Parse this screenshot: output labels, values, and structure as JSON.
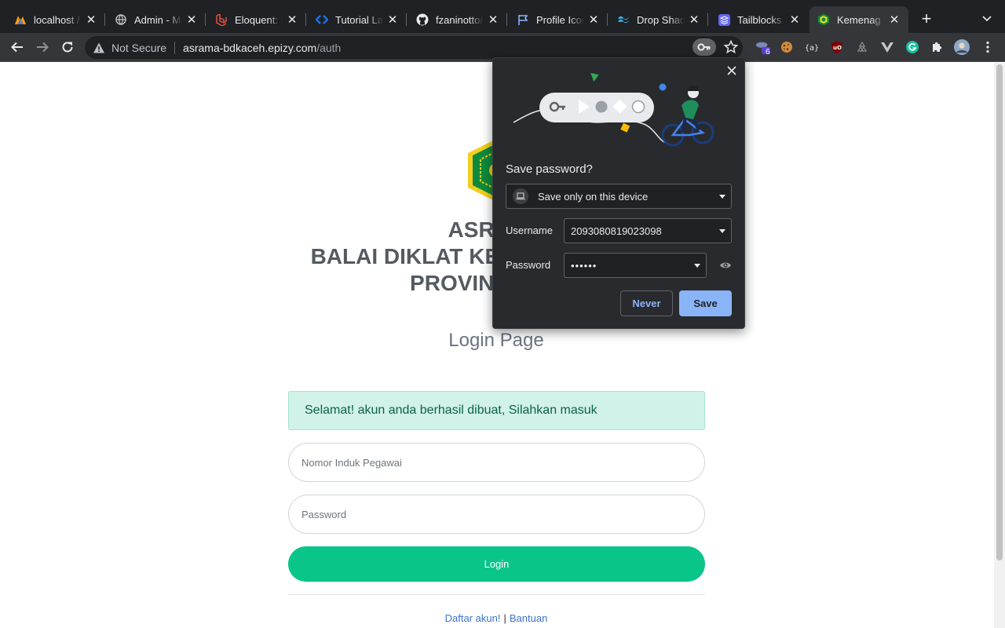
{
  "browser": {
    "tabs": [
      {
        "title": "localhost / ",
        "icon": "phpmyadmin-icon"
      },
      {
        "title": "Admin - Mu",
        "icon": "globe-icon"
      },
      {
        "title": "Eloquent: M",
        "icon": "laravel-icon"
      },
      {
        "title": "Tutorial Lar",
        "icon": "code-icon"
      },
      {
        "title": "fzaninotto/f",
        "icon": "github-icon"
      },
      {
        "title": "Profile Icon",
        "icon": "flag-icon"
      },
      {
        "title": "Drop Shado",
        "icon": "tailwind-icon"
      },
      {
        "title": "Tailblocks -",
        "icon": "stack-icon"
      },
      {
        "title": "Kemenag L",
        "icon": "kemenag-icon",
        "active": true
      }
    ],
    "new_tab_label": "+",
    "security_label": "Not Secure",
    "url_host": "asrama-bdkaceh.epizy.com",
    "url_path": "/auth",
    "extension_badge": "6"
  },
  "page": {
    "heading_line1": "ASRAMA",
    "heading_line2": "BALAI DIKLAT KEAGAMAAN ACEH",
    "heading_line3": "PROVINSI ACEH",
    "subtitle": "Login Page",
    "alert_text": "Selamat! akun anda berhasil dibuat, Silahkan masuk",
    "nip_placeholder": "Nomor Induk Pegawai",
    "password_placeholder": "Password",
    "login_label": "Login",
    "register_link": "Daftar akun!",
    "separator": "|",
    "help_link": "Bantuan"
  },
  "password_popup": {
    "title": "Save password?",
    "storage_option": "Save only on this device",
    "username_label": "Username",
    "username_value": "2093080819023098",
    "password_label": "Password",
    "password_value": "••••••",
    "never_label": "Never",
    "save_label": "Save"
  },
  "colors": {
    "accent_green": "#0ac58a",
    "alert_bg": "#d1f2e8",
    "popup_bg": "#292a2d",
    "popup_accent": "#8ab4f8"
  }
}
